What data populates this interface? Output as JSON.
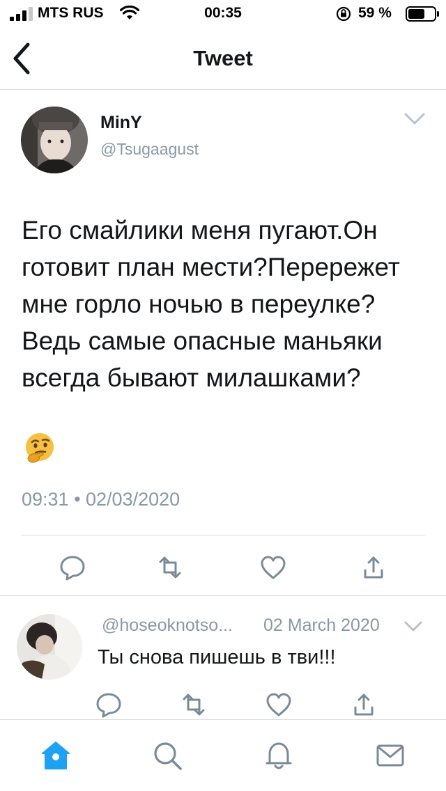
{
  "status_bar": {
    "carrier": "MTS RUS",
    "time": "00:35",
    "battery": "59 %"
  },
  "nav": {
    "title": "Tweet",
    "back_icon": "chevron-left-icon"
  },
  "tweet": {
    "author_name": "MinY",
    "author_handle": "@Tsugaagust",
    "text": "Его смайлики меня пугают.Он готовит план мести?Перережет мне горло ночью в переулке?Ведь самые опасные маньяки всегда бывают милашками?",
    "emoji": "thinking-face-emoji",
    "timestamp": "09:31 • 02/03/2020",
    "actions": [
      "reply-icon",
      "retweet-icon",
      "like-icon",
      "share-icon"
    ]
  },
  "reply": {
    "handle": "@hoseoknotso...",
    "date": "02 March 2020",
    "text": "Ты снова пишешь в тви!!!",
    "actions": [
      "reply-icon",
      "retweet-icon",
      "like-icon",
      "share-icon"
    ]
  },
  "tab_bar": {
    "items": [
      "home-icon",
      "search-icon",
      "notifications-icon",
      "messages-icon"
    ],
    "active": "home-icon"
  },
  "colors": {
    "accent": "#1da1f2",
    "text": "#14171a",
    "secondary": "#8899a6",
    "divider": "#d9dde0"
  }
}
